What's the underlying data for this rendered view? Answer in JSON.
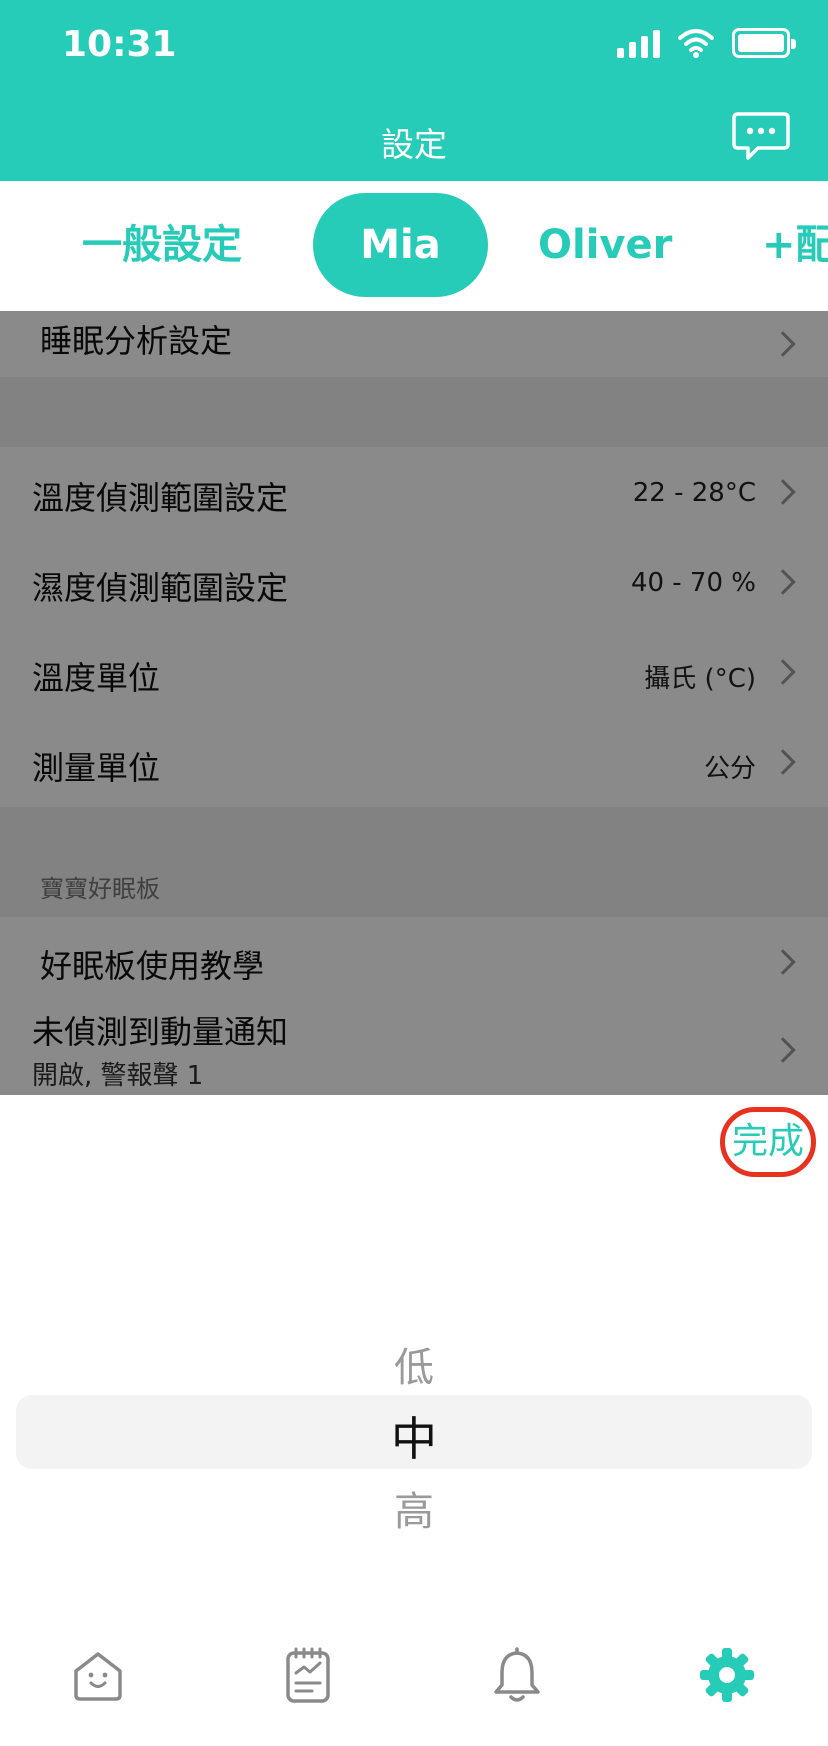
{
  "status_bar": {
    "time": "10:31"
  },
  "header": {
    "title": "設定",
    "chat_icon": "chat-bubble-icon"
  },
  "tabs": [
    {
      "label": "一般設定",
      "active": false
    },
    {
      "label": "Mia",
      "active": true
    },
    {
      "label": "Oliver",
      "active": false
    },
    {
      "label": "+配",
      "active": false
    }
  ],
  "settings": {
    "sleep_analysis": {
      "label": "睡眠分析設定"
    },
    "temperature_range": {
      "label": "溫度偵測範圍設定",
      "value": "22 - 28°C"
    },
    "humidity_range": {
      "label": "濕度偵測範圍設定",
      "value": "40 - 70 %"
    },
    "temperature_unit": {
      "label": "溫度單位",
      "value": "攝氏 (°C)"
    },
    "measure_unit": {
      "label": "測量單位",
      "value": "公分"
    },
    "section_title": "寶寶好眠板",
    "tutorial": {
      "label": "好眠板使用教學"
    },
    "no_motion": {
      "label": "未偵測到動量通知",
      "subtext": "開啟, 警報聲 1"
    }
  },
  "picker": {
    "done_label": "完成",
    "options": [
      "低",
      "中",
      "高"
    ],
    "selected": "中"
  },
  "bottom_nav": {
    "items": [
      "home-icon",
      "report-icon",
      "bell-icon",
      "settings-gear-icon"
    ],
    "active": "settings-gear-icon"
  },
  "colors": {
    "accent": "#27ccb8",
    "highlight_ring": "#e8311f"
  }
}
